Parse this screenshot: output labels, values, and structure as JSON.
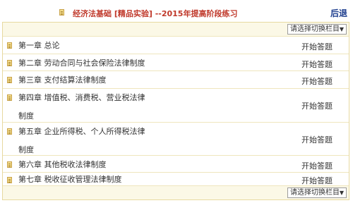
{
  "header": {
    "title": "经济法基础 [精品实验] --2015年提高阶段练习",
    "back_label": "后退"
  },
  "switcher": {
    "label": "请选择切换栏目",
    "arrow": "▼"
  },
  "chapters": [
    {
      "name": "第一章  总论",
      "action": "开始答题"
    },
    {
      "name": "第二章  劳动合同与社会保险法律制度",
      "action": "开始答题"
    },
    {
      "name": "第三章  支付结算法律制度",
      "action": "开始答题"
    },
    {
      "name": "第四章  增值税、消费税、营业税法律制度",
      "action": "开始答题"
    },
    {
      "name": "第五章  企业所得税、个人所得税法律制度",
      "action": "开始答题"
    },
    {
      "name": "第六章  其他税收法律制度",
      "action": "开始答题"
    },
    {
      "name": "第七章    税收征收管理法律制度",
      "action": "开始答题"
    }
  ]
}
